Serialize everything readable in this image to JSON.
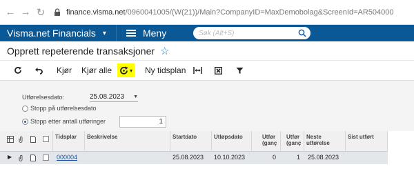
{
  "browser": {
    "url_host": "finance.visma.net",
    "url_path": "/0960041005/(W(21))/Main?CompanyID=MaxDemobolag&ScreenId=AR504000"
  },
  "app": {
    "title": "Visma.net Financials",
    "menu_label": "Meny",
    "search_placeholder": "Søk (Alt+S)",
    "brand_color": "#0a5996"
  },
  "page": {
    "title": "Opprett repeterende transaksjoner"
  },
  "toolbar": {
    "run_label": "Kjør",
    "run_all_label": "Kjør alle",
    "new_schedule_label": "Ny tidsplan"
  },
  "form": {
    "exec_date_label": "Utførelsesdato:",
    "exec_date_value": "25.08.2023",
    "stop_on_date_label": "Stopp på utførelsesdato",
    "stop_after_count_label": "Stopp etter antall utføringer",
    "count_value": "1"
  },
  "grid": {
    "headers": {
      "schedule": "Tidsplar",
      "description": "Beskrivelse",
      "start_date": "Startdato",
      "expiry_date": "Utløpsdato",
      "executed_line1": "Utfør",
      "executed_line2": "(ganç",
      "executions_line1": "Utfør",
      "executions_line2": "(ganç",
      "next_exec_line1": "Neste",
      "next_exec_line2": "utførelse",
      "last_executed": "Sist utført"
    },
    "rows": [
      {
        "schedule": "000004",
        "description": "",
        "start_date": "25.08.2023",
        "expiry_date": "10.10.2023",
        "executed": "0",
        "executions": "1",
        "next_exec": "25.08.2023",
        "last_executed": ""
      }
    ]
  }
}
